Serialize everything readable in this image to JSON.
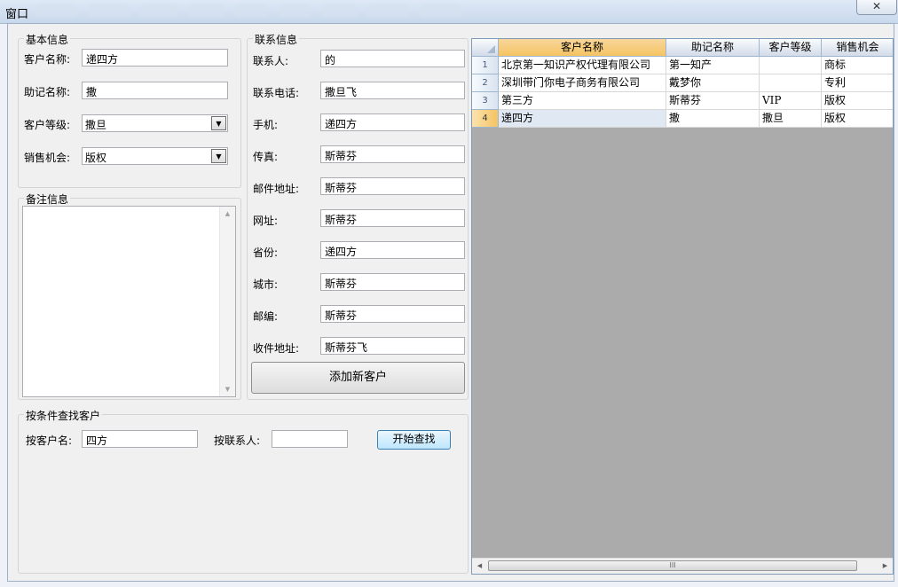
{
  "window": {
    "title": "窗口",
    "close_glyph": "✕"
  },
  "toolbar_blurred": [
    "",
    ""
  ],
  "basic_info": {
    "group_title": "基本信息",
    "customer_name": {
      "label": "客户名称:",
      "value": "递四方"
    },
    "mnemonic": {
      "label": "助记名称:",
      "value": "撒"
    },
    "level": {
      "label": "客户等级:",
      "value": "撒旦"
    },
    "sales_opportunity": {
      "label": "销售机会:",
      "value": "版权"
    }
  },
  "notes": {
    "group_title": "备注信息",
    "value": ""
  },
  "contact_info": {
    "group_title": "联系信息",
    "fields": [
      {
        "label": "联系人:",
        "value": "的"
      },
      {
        "label": "联系电话:",
        "value": "撒旦飞"
      },
      {
        "label": "手机:",
        "value": "递四方"
      },
      {
        "label": "传真:",
        "value": "斯蒂芬"
      },
      {
        "label": "邮件地址:",
        "value": "斯蒂芬"
      },
      {
        "label": "网址:",
        "value": "斯蒂芬"
      },
      {
        "label": "省份:",
        "value": "递四方"
      },
      {
        "label": "城市:",
        "value": "斯蒂芬"
      },
      {
        "label": "邮编:",
        "value": "斯蒂芬"
      },
      {
        "label": "收件地址:",
        "value": "斯蒂芬飞"
      }
    ],
    "add_button": "添加新客户"
  },
  "search": {
    "group_title": "按条件查找客户",
    "by_name_label": "按客户名:",
    "by_name_value": "四方",
    "by_contact_label": "按联系人:",
    "by_contact_value": "",
    "search_button": "开始查找"
  },
  "grid": {
    "columns": [
      "客户名称",
      "助记名称",
      "客户等级",
      "销售机会"
    ],
    "rows": [
      {
        "no": "1",
        "cells": [
          "北京第一知识产权代理有限公司",
          "第一知产",
          "",
          "商标"
        ]
      },
      {
        "no": "2",
        "cells": [
          "深圳带门你电子商务有限公司",
          "戴梦你",
          "",
          "专利"
        ]
      },
      {
        "no": "3",
        "cells": [
          "第三方",
          "斯蒂芬",
          "VIP",
          "版权"
        ]
      },
      {
        "no": "4",
        "cells": [
          "递四方",
          "撒",
          "撒旦",
          "版权"
        ]
      }
    ],
    "scroll_grip": "III"
  }
}
